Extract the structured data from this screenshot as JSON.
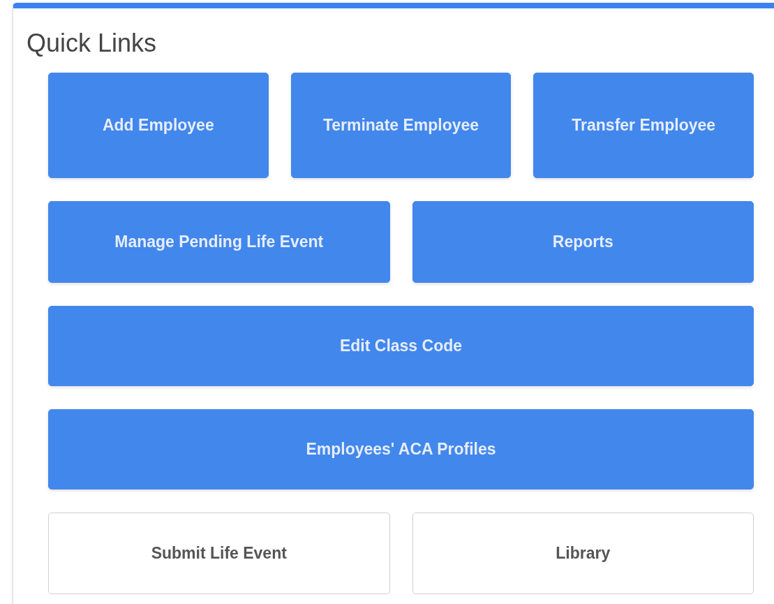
{
  "card": {
    "title": "Quick Links",
    "rows": [
      [
        {
          "label": "Add Employee",
          "kind": "primary"
        },
        {
          "label": "Terminate Employee",
          "kind": "primary"
        },
        {
          "label": "Transfer Employee",
          "kind": "primary"
        }
      ],
      [
        {
          "label": "Manage Pending Life Event",
          "kind": "primary"
        },
        {
          "label": "Reports",
          "kind": "primary"
        }
      ],
      [
        {
          "label": "Edit Class Code",
          "kind": "primary"
        }
      ],
      [
        {
          "label": "Employees' ACA Profiles",
          "kind": "primary"
        }
      ],
      [
        {
          "label": "Submit Life Event",
          "kind": "outline"
        },
        {
          "label": "Library",
          "kind": "outline"
        }
      ]
    ]
  }
}
